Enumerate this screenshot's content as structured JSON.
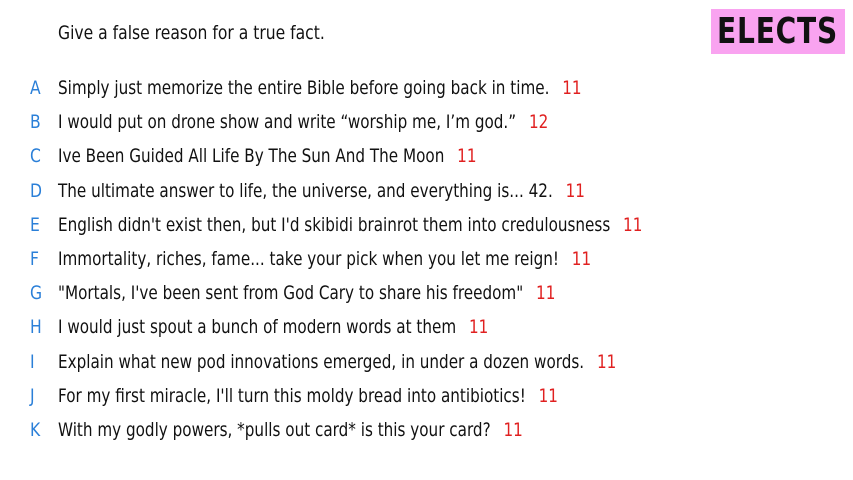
{
  "prompt": "Give a false reason for a true fact.",
  "badge": {
    "label": "ELECTS",
    "color": "#f9a3f0"
  },
  "colors": {
    "letter": "#2a7fd8",
    "votes": "#e02020",
    "text": "#111111"
  },
  "answers": [
    {
      "letter": "A",
      "text": "Simply just memorize the entire Bible before going back in time.",
      "votes": "11"
    },
    {
      "letter": "B",
      "text": "I would put on drone show and write “worship me, I’m god.”",
      "votes": "12"
    },
    {
      "letter": "C",
      "text": "Ive Been Guided All Life By The Sun And The Moon",
      "votes": "11"
    },
    {
      "letter": "D",
      "text": "The ultimate answer to life, the universe, and everything is... 42.",
      "votes": "11"
    },
    {
      "letter": "E",
      "text": "English didn't exist then, but I'd skibidi brainrot them into credulousness",
      "votes": "11"
    },
    {
      "letter": "F",
      "text": "Immortality, riches, fame... take your pick when you let me reign!",
      "votes": "11"
    },
    {
      "letter": "G",
      "text": "\"Mortals, I've been sent from God Cary to share his freedom\"",
      "votes": "11"
    },
    {
      "letter": "H",
      "text": "I would just spout a bunch of modern words at them",
      "votes": "11"
    },
    {
      "letter": "I",
      "text": "Explain what new pod innovations emerged, in under a dozen words.",
      "votes": "11"
    },
    {
      "letter": "J",
      "text": "For my first miracle, I'll turn this moldy bread into antibiotics!",
      "votes": "11"
    },
    {
      "letter": "K",
      "text": "With my godly powers, *pulls out card* is this your card?",
      "votes": "11"
    }
  ]
}
